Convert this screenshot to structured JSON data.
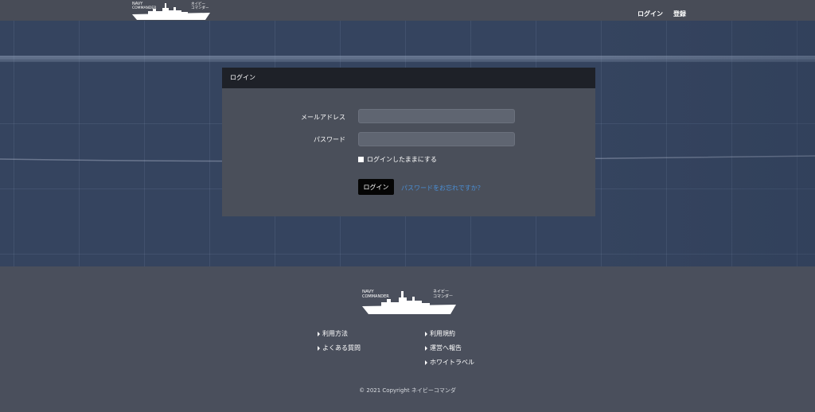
{
  "header": {
    "logo": {
      "en_line1": "NAVY",
      "en_line2": "COMMANDER",
      "jp_line1": "ネイビー",
      "jp_line2": "コマンダー"
    },
    "nav": {
      "login": "ログイン",
      "register": "登録"
    }
  },
  "login_card": {
    "title": "ログイン",
    "email_label": "メールアドレス",
    "email_value": "",
    "password_label": "パスワード",
    "password_value": "",
    "remember_label": "ログインしたままにする",
    "submit_label": "ログイン",
    "forgot_label": "パスワードをお忘れですか？"
  },
  "footer": {
    "logo": {
      "en_line1": "NAVY",
      "en_line2": "COMMANDER",
      "jp_line1": "ネイビー",
      "jp_line2": "コマンダー"
    },
    "links_left": [
      "利用方法",
      "よくある質問"
    ],
    "links_right": [
      "利用規約",
      "運営へ報告",
      "ホワイトラベル"
    ],
    "copyright": "© 2021 Copyright ネイビーコマンダ"
  },
  "colors": {
    "header_bg": "#484c57",
    "hero_bg": "#35445f",
    "card_header_bg": "#1e2128",
    "card_bg": "#4a4f5a",
    "link_blue": "#4a8fd6",
    "footer_bg": "#4a4f5c"
  }
}
